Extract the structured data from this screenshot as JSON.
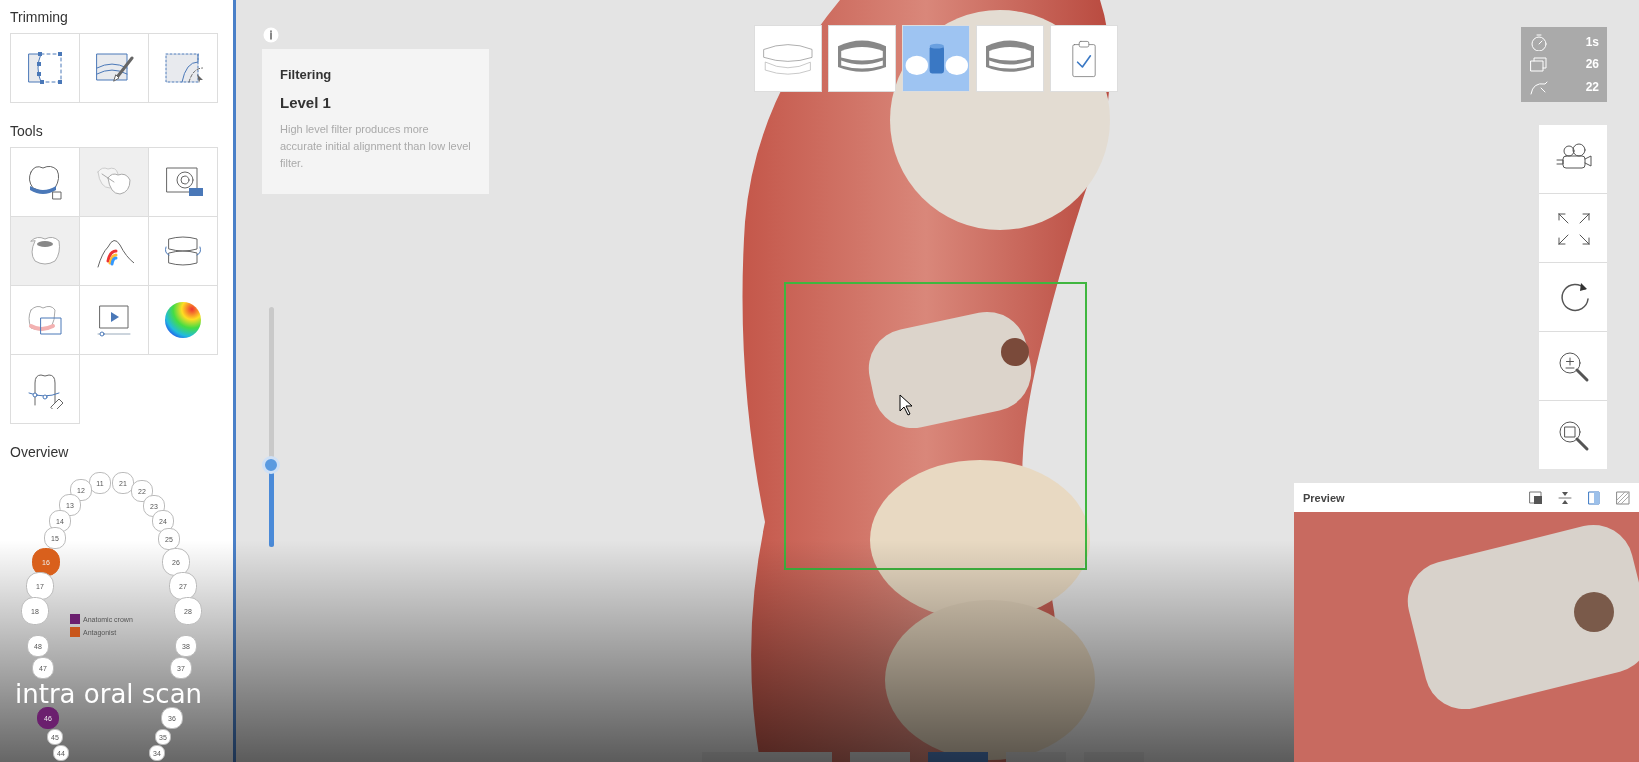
{
  "sidebar": {
    "sections": [
      {
        "title": "Trimming",
        "tools": [
          {
            "selected": false
          },
          {
            "selected": false
          },
          {
            "selected": false
          }
        ]
      },
      {
        "title": "Tools",
        "tools": [
          {
            "selected": false
          },
          {
            "selected": true
          },
          {
            "selected": false
          },
          {
            "selected": true
          },
          {
            "selected": false
          },
          {
            "selected": false
          },
          {
            "selected": false
          },
          {
            "selected": false
          },
          {
            "selected": false
          },
          {
            "selected": false
          }
        ]
      }
    ],
    "overview": {
      "title": "Overview",
      "teeth": [
        {
          "label": "11"
        },
        {
          "label": "21"
        },
        {
          "label": "12"
        },
        {
          "label": "22"
        },
        {
          "label": "13"
        },
        {
          "label": "23"
        },
        {
          "label": "14"
        },
        {
          "label": "24"
        },
        {
          "label": "15"
        },
        {
          "label": "25"
        },
        {
          "label": "16",
          "color": "#d9601c"
        },
        {
          "label": "26"
        },
        {
          "label": "17"
        },
        {
          "label": "27"
        },
        {
          "label": "18"
        },
        {
          "label": "28"
        },
        {
          "label": "48"
        },
        {
          "label": "38"
        },
        {
          "label": "47"
        },
        {
          "label": "37"
        },
        {
          "label": "46",
          "color": "#6b1f6e"
        },
        {
          "label": "36"
        },
        {
          "label": "45"
        },
        {
          "label": "35"
        },
        {
          "label": "44"
        },
        {
          "label": "34"
        }
      ],
      "legend": [
        {
          "label": "Anatomic crown",
          "color": "#6b1f6e"
        },
        {
          "label": "Antagonist",
          "color": "#c8561c"
        }
      ]
    }
  },
  "caption": "intra oral scan",
  "info_card": {
    "title": "Filtering",
    "level_label": "Level 1",
    "description": "High level filter produces more accurate initial alignment than low level filter."
  },
  "filter_slider": {
    "level": 0.34
  },
  "stages": [
    {
      "selected": false
    },
    {
      "selected": false
    },
    {
      "selected": true
    },
    {
      "selected": false
    },
    {
      "selected": false
    }
  ],
  "stats": [
    {
      "value": "1s"
    },
    {
      "value": "26"
    },
    {
      "value": "22"
    }
  ],
  "preview": {
    "title": "Preview"
  }
}
